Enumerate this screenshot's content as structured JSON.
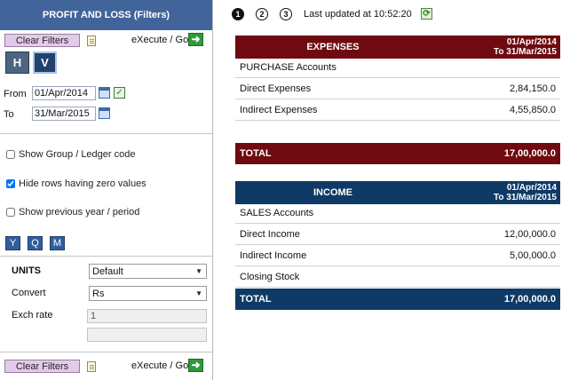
{
  "filters": {
    "title": "PROFIT AND LOSS (Filters)",
    "clear_label": "Clear Filters",
    "execute_label": "eXecute / Go",
    "h_label": "H",
    "v_label": "V",
    "from_label": "From",
    "from_value": "01/Apr/2014",
    "to_label": "To",
    "to_value": "31/Mar/2015",
    "checkboxes": [
      {
        "label": "Show Group / Ledger code",
        "checked": false
      },
      {
        "label": "Hide rows having zero values",
        "checked": true
      },
      {
        "label": "Show previous year / period",
        "checked": false
      }
    ],
    "period_buttons": [
      "Y",
      "Q",
      "M"
    ],
    "units_label": "UNITS",
    "units_value": "Default",
    "convert_label": "Convert",
    "convert_value": "Rs",
    "exch_label": "Exch rate",
    "exch_value": "1",
    "extra_value": ""
  },
  "toolbar": {
    "step1": "1",
    "step2": "2",
    "step3": "3",
    "last_updated_label": "Last updated at",
    "last_updated_time": "10:52:20"
  },
  "expenses": {
    "title": "EXPENSES",
    "period_from": "01/Apr/2014",
    "period_to": "To  31/Mar/2015",
    "rows": [
      {
        "label": "PURCHASE Accounts",
        "value": ""
      },
      {
        "label": "Direct Expenses",
        "value": "2,84,150.0"
      },
      {
        "label": "Indirect Expenses",
        "value": "4,55,850.0"
      }
    ],
    "total_label": "TOTAL",
    "total_value": "17,00,000.0"
  },
  "income": {
    "title": "INCOME",
    "period_from": "01/Apr/2014",
    "period_to": "To  31/Mar/2015",
    "rows": [
      {
        "label": "SALES Accounts",
        "value": ""
      },
      {
        "label": "Direct Income",
        "value": "12,00,000.0"
      },
      {
        "label": "Indirect Income",
        "value": "5,00,000.0"
      },
      {
        "label": "Closing Stock",
        "value": ""
      }
    ],
    "total_label": "TOTAL",
    "total_value": "17,00,000.0"
  },
  "colors": {
    "filter_header": "#41659a",
    "expenses_header": "#6e0a10",
    "income_header": "#0f3a66"
  },
  "icons": {
    "doc": "document-icon",
    "go": "go-arrow-icon",
    "calendar": "calendar-icon",
    "refresh": "refresh-icon"
  }
}
